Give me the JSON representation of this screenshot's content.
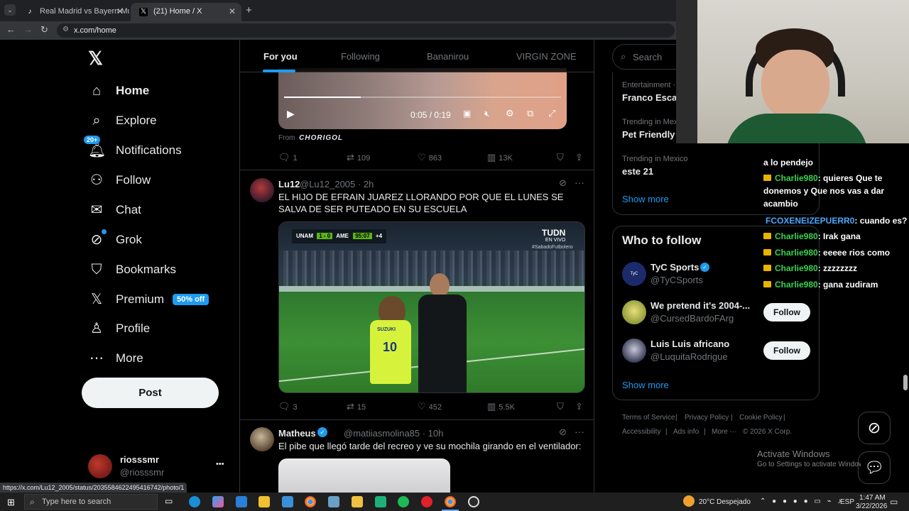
{
  "browser": {
    "tabs": [
      {
        "title": "Real Madrid vs Bayern Munich",
        "active": false
      },
      {
        "title": "(21) Home / X",
        "active": true
      }
    ],
    "url": "x.com/home",
    "status_url": "https://x.com/Lu12_2005/status/2035584622495416742/photo/1"
  },
  "nav": {
    "home": "Home",
    "explore": "Explore",
    "notifications": "Notifications",
    "notifications_badge": "20+",
    "follow": "Follow",
    "chat": "Chat",
    "grok": "Grok",
    "bookmarks": "Bookmarks",
    "premium": "Premium",
    "premium_pill": "50% off",
    "profile": "Profile",
    "more": "More",
    "post": "Post"
  },
  "account": {
    "name": "riosssmr",
    "handle": "@riosssmr",
    "menu": "•••"
  },
  "feed": {
    "tabs": [
      "For you",
      "Following",
      "Bananirou",
      "VIRGIN ZONE"
    ],
    "video_time": "0:05 / 0:19",
    "video_from_label": "From",
    "video_from_source": "CHORIGOL",
    "tweet0_actions": {
      "replies": "1",
      "reposts": "109",
      "likes": "863",
      "views": "13K"
    },
    "tweet1": {
      "name": "Lu12",
      "handle_time": "@Lu12_2005 · 2h",
      "text": "EL HIJO DE EFRAIN JUAREZ LLORANDO POR QUE EL LUNES SE SALVA DE SER PUTEADO EN SU ESCUELA",
      "media_overlay": {
        "broadcaster": "TUDN",
        "live": "EN VIVO",
        "score_home": "UNAM",
        "score": "1 - 0",
        "score_away": "AME",
        "clock": "95:07",
        "added": "+4",
        "hashtag": "#SabadoFutbolero",
        "shirt_number": "10",
        "shirt_sponsor": "SUZUKI"
      },
      "actions": {
        "replies": "3",
        "reposts": "15",
        "likes": "452",
        "views": "5.5K"
      }
    },
    "tweet2": {
      "name": "Matheus",
      "handle_time": "@matiiasmolina85 · 10h",
      "text": "El pibe que llegó tarde del recreo y ve su mochila girando en el ventilador:"
    }
  },
  "sidebar": {
    "search_placeholder": "Search",
    "trends": [
      {
        "meta": "Entertainment · Trending",
        "name": "Franco Escamilla"
      },
      {
        "meta": "Trending in Mexico",
        "name": "Pet Friendly"
      },
      {
        "meta": "Trending in Mexico",
        "name": "este 21"
      }
    ],
    "show_more": "Show more",
    "who_to_follow_title": "Who to follow",
    "who_to_follow": [
      {
        "name": "TyC Sports",
        "handle": "@TyCSports",
        "button": "Follow",
        "verified": true
      },
      {
        "name": "We pretend it's 2004-...",
        "handle": "@CursedBardoFArg",
        "button": "Follow",
        "verified": false
      },
      {
        "name": "Luis Luis africano",
        "handle": "@LuquitaRodrigue",
        "button": "Follow",
        "verified": false
      }
    ],
    "wtf_show_more": "Show more",
    "footer": [
      "Terms of Service",
      "Privacy Policy",
      "Cookie Policy",
      "Accessibility",
      "Ads info",
      "More ···",
      "© 2026 X Corp."
    ]
  },
  "stream_chat": [
    {
      "user": "",
      "message": "a lo pendejo"
    },
    {
      "user": "Charlie980",
      "message": ": quieres Que te donemos y Que nos vas a dar acambio"
    },
    {
      "user": "FCOXENEIZEPUERR0",
      "message": ": cuando es?"
    },
    {
      "user": "Charlie980",
      "message": ": Irak gana"
    },
    {
      "user": "Charlie980",
      "message": ": eeeee rios como"
    },
    {
      "user": "Charlie980",
      "message": ": zzzzzzzz"
    },
    {
      "user": "Charlie980",
      "message": ": gana zudiram"
    }
  ],
  "windows_watermark": {
    "title": "Activate Windows",
    "subtitle": "Go to Settings to activate Windows."
  },
  "taskbar": {
    "search_placeholder": "Type here to search",
    "weather": "20°C  Despejado",
    "lang": "ESP",
    "time": "1:47 AM",
    "date": "3/22/2026"
  },
  "colors": {
    "accent": "#1d9bf0",
    "background": "#000000",
    "border": "#2f3336",
    "muted": "#71767b",
    "chat_user": "#39d353"
  }
}
